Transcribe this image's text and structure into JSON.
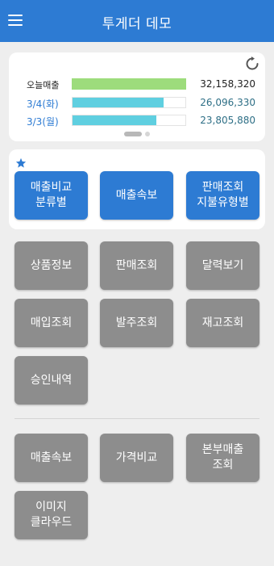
{
  "app": {
    "title": "투게더 데모"
  },
  "sales": {
    "rows": [
      {
        "label": "오늘매출",
        "value": "32,158,320",
        "ratio": 1.0,
        "color": "#9ddc7c"
      },
      {
        "label": "3/4(화)",
        "value": "26,096,330",
        "ratio": 0.81,
        "color": "#5fcfe0"
      },
      {
        "label": "3/3(월)",
        "value": "23,805,880",
        "ratio": 0.74,
        "color": "#5fcfe0"
      }
    ]
  },
  "favorites": {
    "tiles": [
      {
        "label": "매출비교\n분류별"
      },
      {
        "label": "매출속보"
      },
      {
        "label": "판매조회\n지불유형별"
      }
    ]
  },
  "menu": {
    "tiles": [
      {
        "label": "상품정보"
      },
      {
        "label": "판매조회"
      },
      {
        "label": "달력보기"
      },
      {
        "label": "매입조회"
      },
      {
        "label": "발주조회"
      },
      {
        "label": "재고조회"
      },
      {
        "label": "승인내역"
      }
    ]
  },
  "extra": {
    "tiles": [
      {
        "label": "매출속보"
      },
      {
        "label": "가격비교"
      },
      {
        "label": "본부매출\n조회"
      },
      {
        "label": "이미지\n클라우드"
      }
    ]
  }
}
